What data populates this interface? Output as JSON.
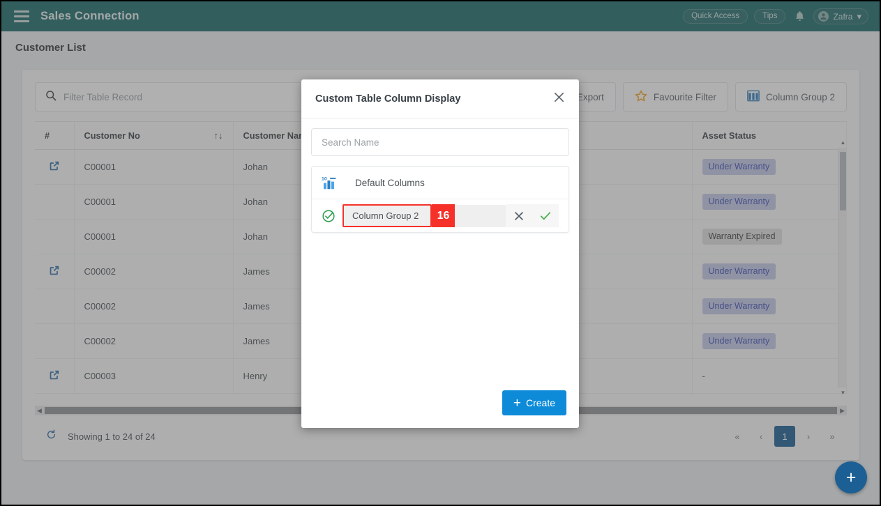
{
  "topbar": {
    "menu_icon": "hamburger-icon",
    "app_title": "Sales Connection",
    "quick_access": "Quick Access",
    "tips": "Tips",
    "bell_icon": "bell-icon",
    "user_name": "Zafra",
    "chevron": "⌄",
    "bg_color": "#1d6b6b"
  },
  "page": {
    "title": "Customer List"
  },
  "toolbar": {
    "search_placeholder": "Filter Table Record",
    "search_value": "",
    "export_label": "Export",
    "favourite_filter_label": "Favourite Filter",
    "column_group_label": "Column Group 2"
  },
  "table": {
    "columns": [
      "#",
      "Customer No",
      "Customer Name",
      "",
      "",
      "Asset Status"
    ],
    "sort_indicator": "↑↓",
    "rows": [
      {
        "link": true,
        "no": "C00001",
        "name": "Johan",
        "status": "Under Warranty",
        "status_kind": "warranty"
      },
      {
        "link": false,
        "no": "C00001",
        "name": "Johan",
        "status": "Under Warranty",
        "status_kind": "warranty"
      },
      {
        "link": false,
        "no": "C00001",
        "name": "Johan",
        "status": "Warranty Expired",
        "status_kind": "expired"
      },
      {
        "link": true,
        "no": "C00002",
        "name": "James",
        "status": "Under Warranty",
        "status_kind": "warranty"
      },
      {
        "link": false,
        "no": "C00002",
        "name": "James",
        "status": "Under Warranty",
        "status_kind": "warranty"
      },
      {
        "link": false,
        "no": "C00002",
        "name": "James",
        "status": "Under Warranty",
        "status_kind": "warranty"
      },
      {
        "link": true,
        "no": "C00003",
        "name": "Henry",
        "status": "-",
        "status_kind": "dash"
      }
    ]
  },
  "footer": {
    "refresh_icon": "refresh-icon",
    "showing": "Showing 1 to 24 of 24",
    "pager": {
      "first": "«",
      "prev": "‹",
      "current": "1",
      "next": "›",
      "last": "»"
    }
  },
  "fab": {
    "label": "+"
  },
  "modal": {
    "title": "Custom Table Column Display",
    "close_icon": "close-icon",
    "search_placeholder": "Search Name",
    "search_value": "",
    "default_group": {
      "icon": "bar-chart-10-icon",
      "label": "Default Columns"
    },
    "edit_row": {
      "status_icon": "check-circle-icon",
      "value": "Column Group 2",
      "cancel_icon": "x-icon",
      "confirm_icon": "check-icon"
    },
    "create_label": "Create",
    "create_plus": "+"
  },
  "annotation": {
    "number": "16",
    "color": "#f6312a"
  }
}
